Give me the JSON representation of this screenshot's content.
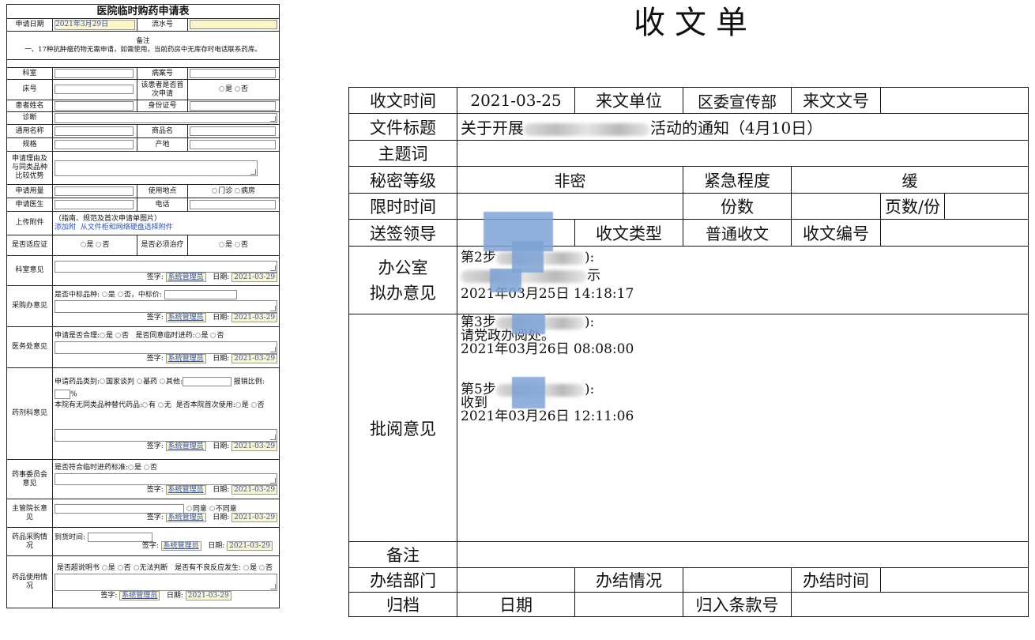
{
  "left_form": {
    "title": "医院临时购药申请表",
    "apply_date_label": "申请日期",
    "apply_date_value": "2021年3月29日",
    "serial_label": "流水号",
    "remark_heading": "备注",
    "remark_text": "一、17种抗肿瘤药物无需申请，如需使用，当前药房中无库存时电话联系药库。",
    "dept_label": "科室",
    "case_no_label": "病案号",
    "bed_label": "床号",
    "first_apply_label": "该患者是否首次申请",
    "yes": "是",
    "no": "否",
    "patient_name_label": "患者姓名",
    "id_label": "身份证号",
    "diagnosis_label": "诊断",
    "generic_name_label": "通用名称",
    "product_name_label": "商品名",
    "spec_label": "规格",
    "origin_label": "产地",
    "reason_label": "申请理由及与同类品种比较优势",
    "dosage_label": "申请用量",
    "place_label": "使用地点",
    "outpatient": "门诊",
    "ward": "病房",
    "doctor_label": "申请医生",
    "phone_label": "电话",
    "upload_label": "上传附件",
    "upload_hint": "（指南、规范及首次申请单图片）",
    "add_attach": "添加附",
    "from_cabinet": "从文件柜和网络硬盘选择附件",
    "indication_label": "是否适应证",
    "must_treat_label": "是否必须治疗",
    "dept_opinion_label": "科室意见",
    "sign_label": "签字:",
    "signer": "系统管理员",
    "date_label": "日期:",
    "date_value": "2021-03-29",
    "purchase_office_label": "采购办意见",
    "bid_question": "是否中标品种:",
    "bid_price": "中标价:",
    "medical_affairs_label": "医务处意见",
    "reasonable_q": "申请是否合理:",
    "agree_temp_q": "是否同意临时进药:",
    "pharmacy_label": "药剂科意见",
    "category_q": "申请药品类别:",
    "national": "国家谈判",
    "basic": "基药",
    "other": "其他:",
    "reimburse": "报销比例:",
    "percent": "%",
    "substitute_q": "本院有无同类品种替代药品:",
    "have": "有",
    "none": "无",
    "first_use_q": "是否本院首次使用:",
    "committee_label": "药事委员会意见",
    "meets_std_q": "是否符合临时进药标准:",
    "dean_label": "主管院长意见",
    "agree": "同意",
    "disagree": "不同意",
    "procure_label": "药品采购情况",
    "arrival_label": "到货时间:",
    "usage_label": "药品使用情况",
    "offlabel_q": "是否超说明书",
    "cannot_judge": "无法判断",
    "adverse_q": "是否有不良反应发生:"
  },
  "right_form": {
    "title": "收文单",
    "receive_time_label": "收文时间",
    "receive_time": "2021-03-25",
    "from_unit_label": "来文单位",
    "from_unit": "区委宣传部",
    "doc_no_label": "来文文号",
    "doc_title_label": "文件标题",
    "doc_title_prefix": "关于开展",
    "doc_title_suffix": "活动的通知（4月10日）",
    "topic_label": "主题词",
    "secret_label": "秘密等级",
    "secret_value": "非密",
    "urgency_label": "紧急程度",
    "urgency_value": "缓",
    "deadline_label": "限时时间",
    "copies_label": "份数",
    "pages_label": "页数/份",
    "leader_label": "送签领导",
    "type_label": "收文类型",
    "type_value": "普通收文",
    "number_label": "收文编号",
    "office_label_1": "办公室",
    "office_label_2": "拟办意见",
    "step2_prefix": "第2步",
    "step2_time": "2021年03月25日 14:18:17",
    "step2_tail": "示",
    "review_label": "批阅意见",
    "step3_prefix": "第3步",
    "step3_text": "请党政办阅处。",
    "step3_time": "2021年03月26日 08:08:00",
    "step5_prefix": "第5步",
    "step5_text": "收到",
    "step5_time": "2021年03月26日 12:11:06",
    "paren_close": "):",
    "note_label": "备注",
    "done_dept_label": "办结部门",
    "done_status_label": "办结情况",
    "done_time_label": "办结时间",
    "archive_label": "归档",
    "date_label": "日期",
    "clause_label": "归入条款号"
  }
}
